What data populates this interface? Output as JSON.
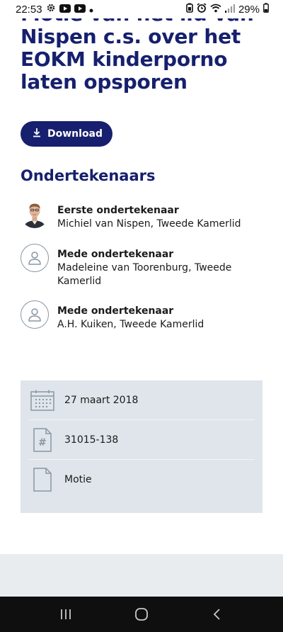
{
  "status_bar": {
    "time": "22:53",
    "battery": "29%"
  },
  "document": {
    "title": "Motie van het lid van Nispen c.s. over het EOKM kinderporno laten opsporen",
    "download_label": "Download"
  },
  "signers": {
    "heading": "Ondertekenaars",
    "items": [
      {
        "role": "Eerste ondertekenaar",
        "name": "Michiel van Nispen, Tweede Kamerlid",
        "avatar": "photo"
      },
      {
        "role": "Mede ondertekenaar",
        "name": "Madeleine van Toorenburg, Tweede Kamerlid",
        "avatar": "person-icon"
      },
      {
        "role": "Mede ondertekenaar",
        "name": "A.H. Kuiken, Tweede Kamerlid",
        "avatar": "person-icon"
      }
    ]
  },
  "meta": {
    "date": "27 maart 2018",
    "number": "31015-138",
    "type": "Motie"
  },
  "colors": {
    "primary": "#16206e",
    "meta_bg": "#dfe5ea",
    "icon_grey": "#8a96a3"
  }
}
